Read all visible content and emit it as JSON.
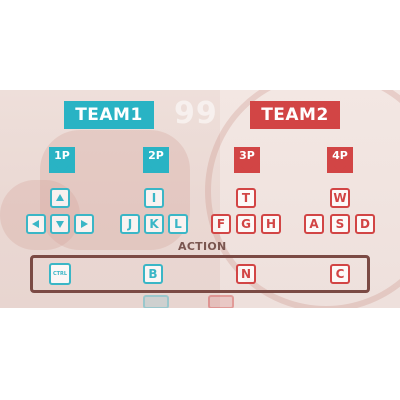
{
  "score_ghost": "99",
  "teams": {
    "team1": {
      "label": "TEAM1",
      "color": "#29b3c4"
    },
    "team2": {
      "label": "TEAM2",
      "color": "#d24545"
    }
  },
  "players": {
    "p1": "1P",
    "p2": "2P",
    "p3": "3P",
    "p4": "4P"
  },
  "keys": {
    "p1": {
      "up": "up-arrow-icon",
      "left": "left-arrow-icon",
      "down": "down-arrow-icon",
      "right": "right-arrow-icon"
    },
    "p2": {
      "up": "I",
      "left": "J",
      "down": "K",
      "right": "L"
    },
    "p3": {
      "up": "T",
      "left": "F",
      "down": "G",
      "right": "H"
    },
    "p4": {
      "up": "W",
      "left": "A",
      "down": "S",
      "right": "D"
    }
  },
  "action": {
    "label": "ACTION",
    "p1": "CTRL",
    "p2": "B",
    "p3": "N",
    "p4": "C"
  }
}
